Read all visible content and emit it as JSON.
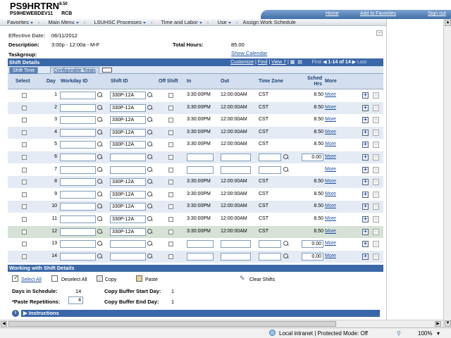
{
  "header": {
    "app_name": "PS9HRTRN",
    "app_version": "8.50",
    "db_name": "PS9HEWEBDEV11",
    "db_suffix": "RCB",
    "links": [
      "Home",
      "Add to Favorites",
      "Sign out"
    ]
  },
  "breadcrumb": [
    "Favorites",
    "Main Menu",
    "LSUHSC Processes",
    "Time and Labor",
    "Use",
    "Assign Work Schedule"
  ],
  "summary": {
    "effective_date_label": "Effective Date:",
    "effective_date": "06/11/2012",
    "description_label": "Description:",
    "description": "3:00p - 12:00a - M-F",
    "total_hours_label": "Total Hours:",
    "total_hours": "85.00",
    "taskgroup_label": "Taskgroup:",
    "show_calendar": "Show Calendar"
  },
  "grid": {
    "title": "Shift Details",
    "nav": {
      "customize": "Customize",
      "find": "Find",
      "view": "View 7",
      "first": "First",
      "range": "1-14 of 14",
      "last": "Last"
    },
    "tabs": [
      "Shift Time",
      "Configurable Totals"
    ],
    "columns": [
      "Select",
      "Day",
      "Workday ID",
      "Shift ID",
      "Off Shift",
      "In",
      "Out",
      "Time Zone",
      "Sched Hrs",
      "More"
    ],
    "more_label": "More",
    "rows": [
      {
        "day": "1",
        "shift": "330P-12A",
        "in": "3:30:00PM",
        "out": "12:00:00AM",
        "tz": "CST",
        "hrs": "8.50"
      },
      {
        "day": "2",
        "shift": "330P-12A",
        "in": "3:30:00PM",
        "out": "12:00:00AM",
        "tz": "CST",
        "hrs": "8.50"
      },
      {
        "day": "3",
        "shift": "330P-12A",
        "in": "3:30:00PM",
        "out": "12:00:00AM",
        "tz": "CST",
        "hrs": "8.50"
      },
      {
        "day": "4",
        "shift": "330P-12A",
        "in": "3:30:00PM",
        "out": "12:00:00AM",
        "tz": "CST",
        "hrs": "8.50"
      },
      {
        "day": "5",
        "shift": "330P-12A",
        "in": "3:30:00PM",
        "out": "12:00:00AM",
        "tz": "CST",
        "hrs": "8.50"
      },
      {
        "day": "6",
        "shift": "",
        "in": "",
        "out": "",
        "tz": "",
        "hrs": "0.00"
      },
      {
        "day": "7",
        "shift": "",
        "in": "",
        "out": "",
        "tz": "",
        "hrs": ""
      },
      {
        "day": "8",
        "shift": "330P-12A",
        "in": "3:30:00PM",
        "out": "12:00:00AM",
        "tz": "CST",
        "hrs": "8.50"
      },
      {
        "day": "9",
        "shift": "330P-12A",
        "in": "3:30:00PM",
        "out": "12:00:00AM",
        "tz": "CST",
        "hrs": "8.50"
      },
      {
        "day": "10",
        "shift": "330P-12A",
        "in": "3:30:00PM",
        "out": "12:00:00AM",
        "tz": "CST",
        "hrs": "8.50"
      },
      {
        "day": "11",
        "shift": "330P-12A",
        "in": "3:30:00PM",
        "out": "12:00:00AM",
        "tz": "CST",
        "hrs": "8.50"
      },
      {
        "day": "12",
        "shift": "330P-12A",
        "in": "3:30:00PM",
        "out": "12:00:00AM",
        "tz": "CST",
        "hrs": "8.50"
      },
      {
        "day": "13",
        "shift": "",
        "in": "",
        "out": "",
        "tz": "",
        "hrs": "0.00"
      },
      {
        "day": "14",
        "shift": "",
        "in": "",
        "out": "",
        "tz": "",
        "hrs": "0.00"
      }
    ]
  },
  "work": {
    "title": "Working with Shift Details",
    "select_all": "Select All",
    "deselect_all": "Deselect All",
    "copy": "Copy",
    "paste": "Paste",
    "clear_shifts": "Clear Shifts",
    "days_label": "Days in Schedule:",
    "days_value": "14",
    "paste_label": "*Paste Repetitions:",
    "paste_value": "4",
    "buf_start_label": "Copy Buffer Start Day:",
    "buf_start_value": "1",
    "buf_end_label": "Copy Buffer End Day:",
    "buf_end_value": "1",
    "instructions": "Instructions"
  },
  "statusbar": {
    "zone": "Local intranet | Protected Mode: Off",
    "zoom": "100%"
  }
}
